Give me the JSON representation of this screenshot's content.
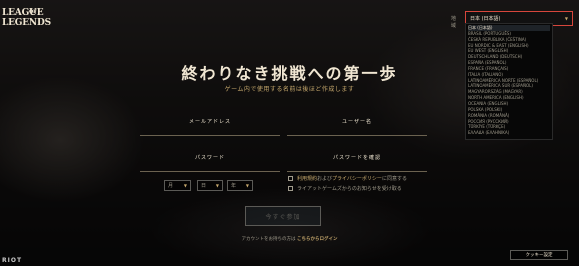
{
  "logo": {
    "line1": "LEAGUE",
    "of": "OF",
    "line2": "LEGENDS"
  },
  "header": {
    "title": "終わりなき挑戦への第一歩",
    "subtitle": "ゲーム内で使用する名前は後ほど作成します"
  },
  "form": {
    "email_label": "メールアドレス",
    "username_label": "ユーザー名",
    "password_label": "パスワード",
    "confirm_password_label": "パスワードを確認",
    "dob": {
      "month": "月",
      "day": "日",
      "year": "年"
    },
    "terms_prefix": "利用規約",
    "terms_mid": "および",
    "privacy": "プライバシーポリシー",
    "terms_suffix": "に同意する",
    "newsletter": "ライアットゲームズからのお知らせを受け取る",
    "submit_label": "今すぐ参加",
    "login_prompt": "アカウントをお持ちの方は",
    "login_link": "こちらからログイン"
  },
  "language": {
    "label": "地域",
    "selected": "日本 (日本語)",
    "options": [
      "日本 (日本語)",
      "BRASIL (PORTUGUÊS)",
      "ČESKÁ REPUBLIKA (ČEŠTINA)",
      "EU NORDIC & EAST (ENGLISH)",
      "EU WEST (ENGLISH)",
      "DEUTSCHLAND (DEUTSCH)",
      "ESPAÑA (ESPAÑOL)",
      "FRANCE (FRANÇAIS)",
      "ITALIA (ITALIANO)",
      "LATINOAMÉRICA NORTE (ESPAÑOL)",
      "LATINOAMÉRICA SUR (ESPAÑOL)",
      "MAGYARORSZÁG (MAGYAR)",
      "NORTH AMERICA (ENGLISH)",
      "OCEANIA (ENGLISH)",
      "POLSKA (POLSKI)",
      "ROMÂNIA (ROMÂNĂ)",
      "РОССИЯ (РУССКИЙ)",
      "TÜRKİYE (TÜRKÇE)",
      "ΕΛΛΑΔΑ (ΕΛΛΗΝΙΚΑ)"
    ]
  },
  "footer": {
    "cookie": "クッキー設定",
    "riot": "RIOT"
  }
}
